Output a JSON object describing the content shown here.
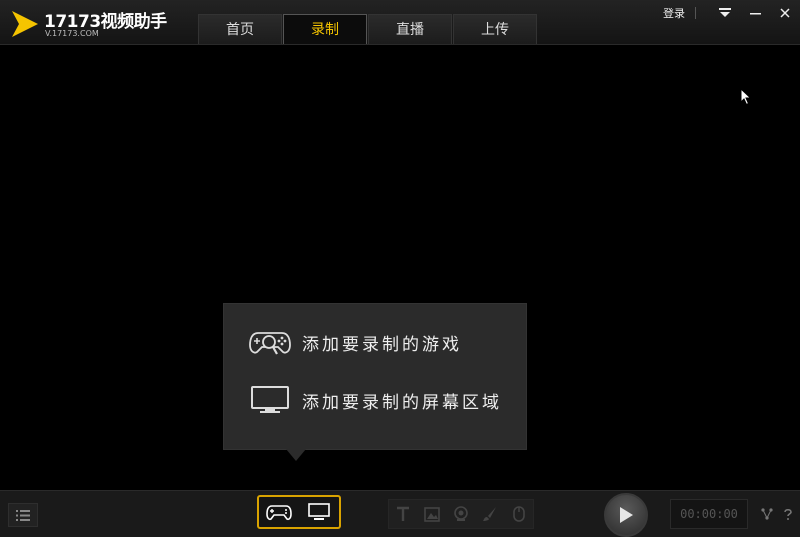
{
  "app": {
    "name": "17173视频助手",
    "url": "V.17173.COM"
  },
  "tabs": [
    {
      "label": "首页",
      "active": false
    },
    {
      "label": "录制",
      "active": true
    },
    {
      "label": "直播",
      "active": false
    },
    {
      "label": "上传",
      "active": false
    }
  ],
  "window": {
    "login_label": "登录"
  },
  "popup": {
    "items": [
      {
        "label": "添加要录制的游戏",
        "icon": "gamepad-search-icon"
      },
      {
        "label": "添加要录制的屏幕区域",
        "icon": "monitor-icon"
      }
    ]
  },
  "bottom": {
    "timer": "00:00:00"
  },
  "colors": {
    "accent": "#f5c400",
    "background": "#000000",
    "popup": "#2b2b2b"
  }
}
